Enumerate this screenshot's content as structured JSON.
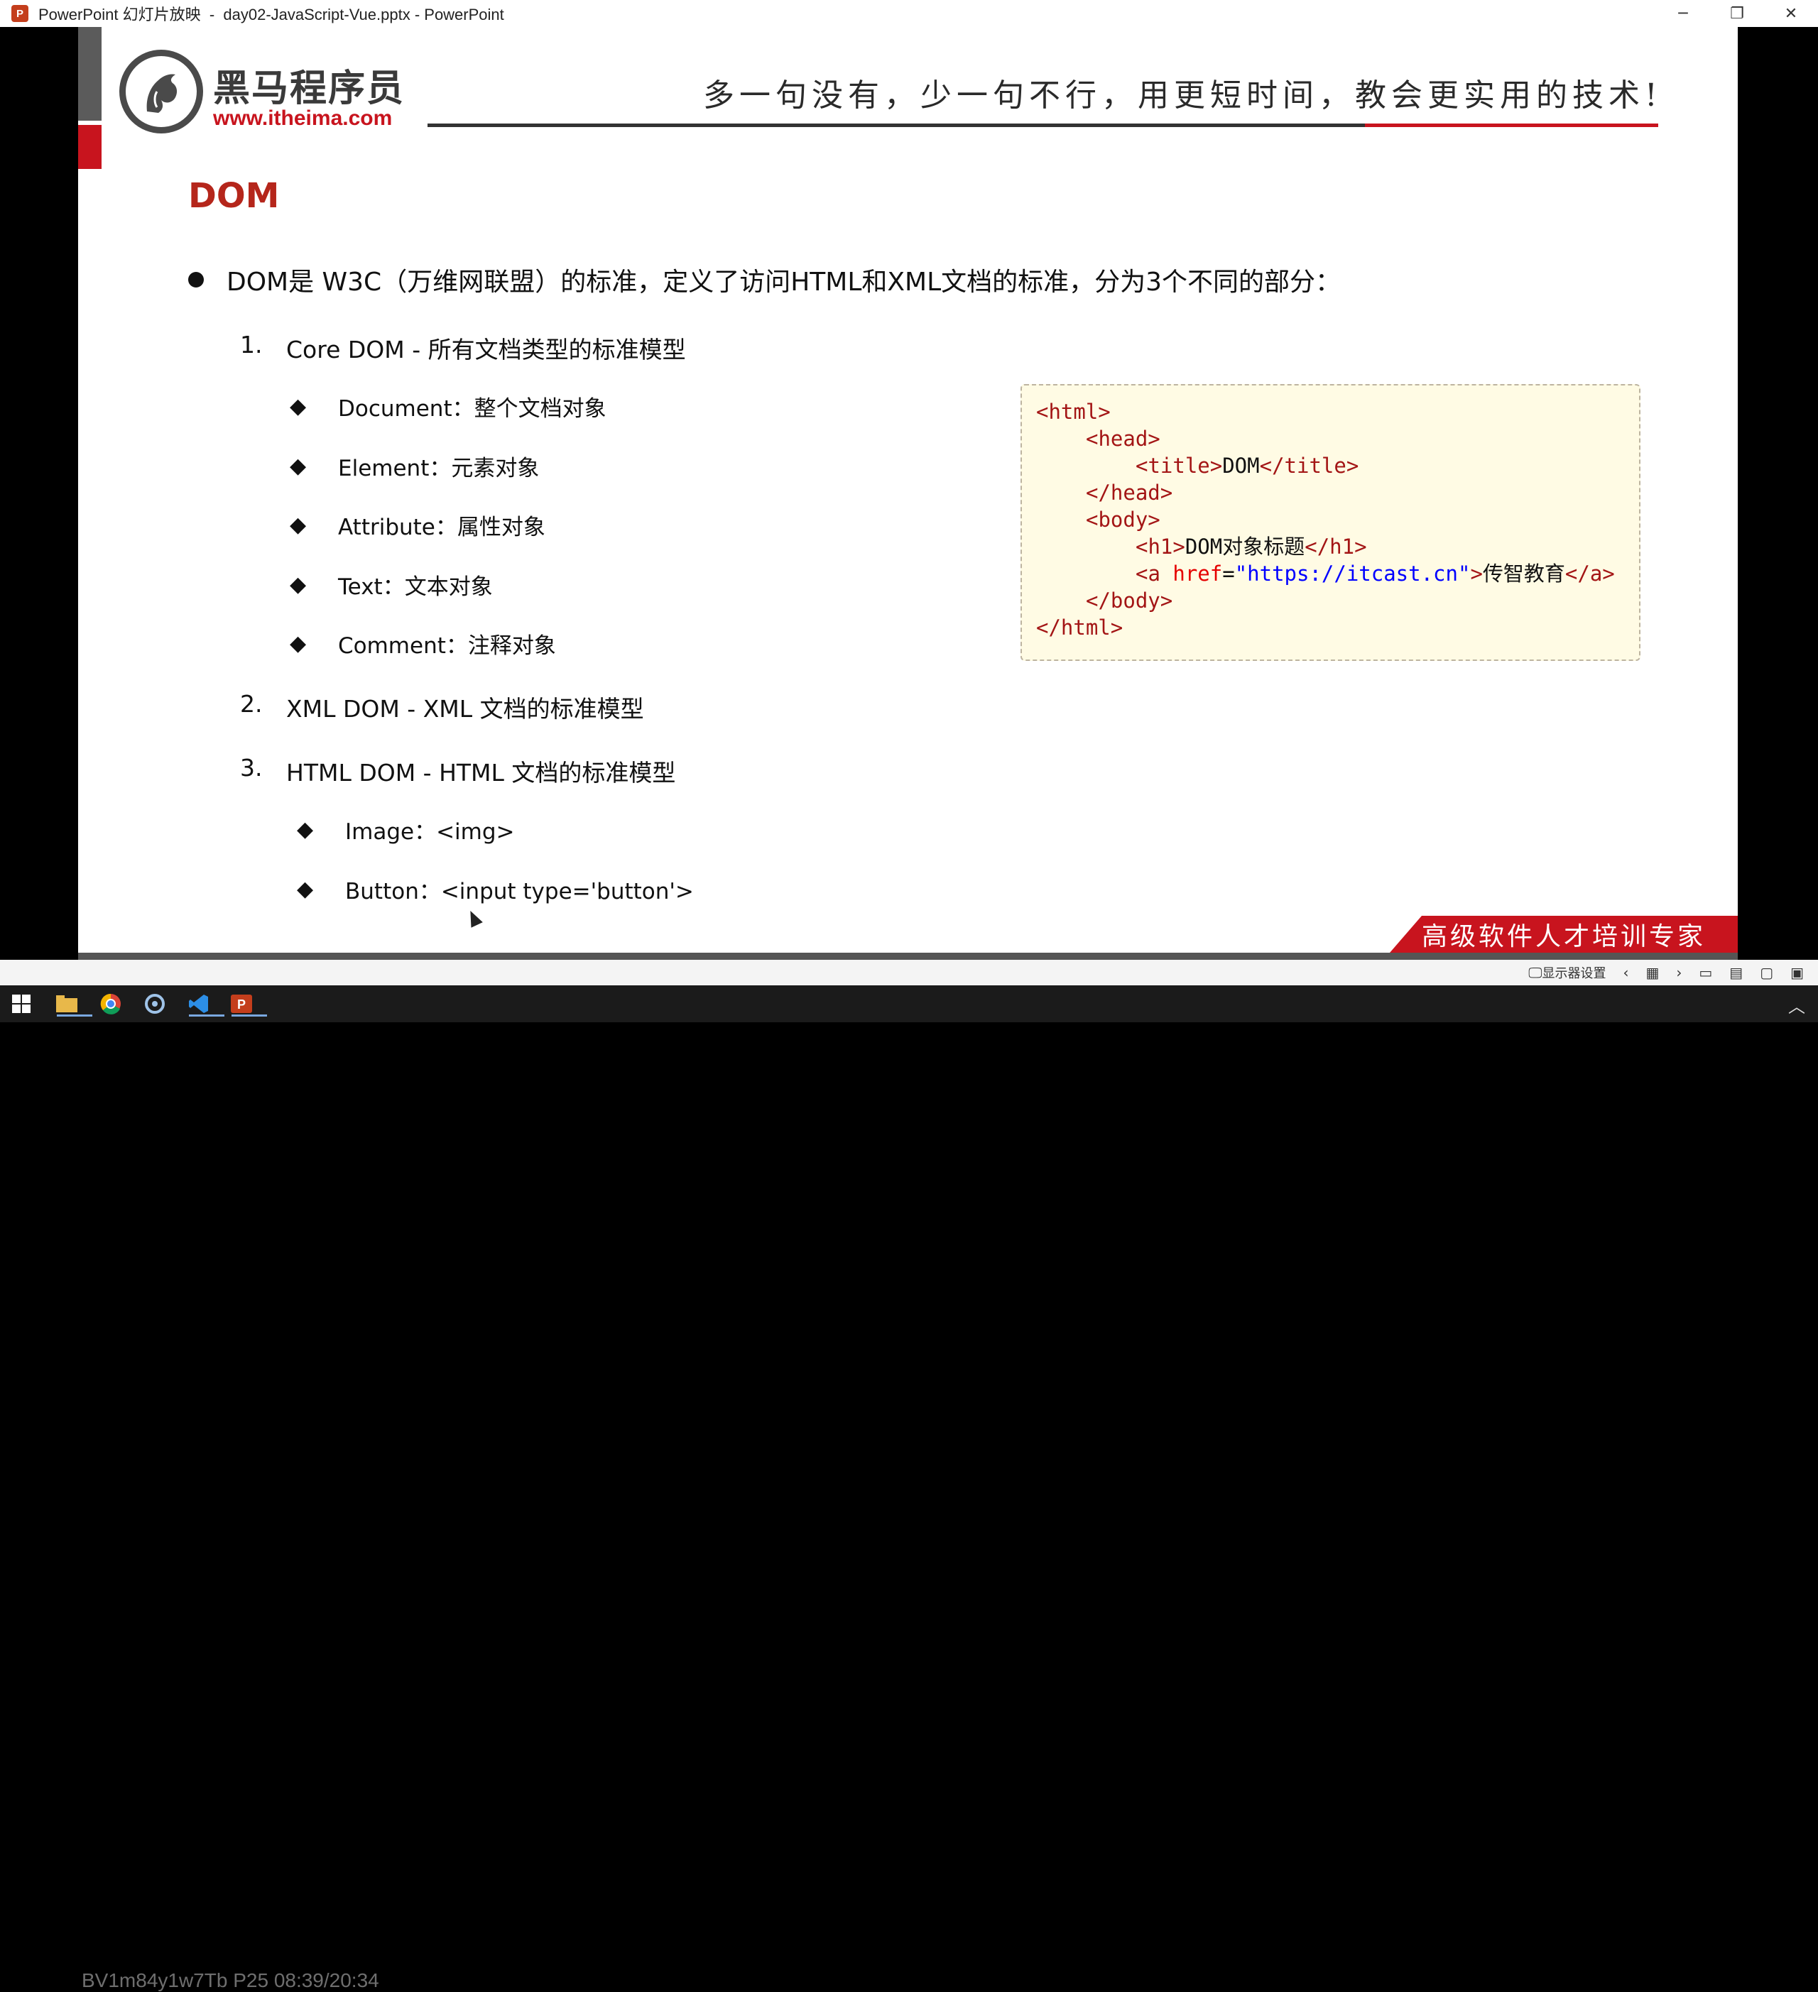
{
  "titlebar": {
    "title": "PowerPoint 幻灯片放映  -  day02-JavaScript-Vue.pptx - PowerPoint",
    "app_icon": "P",
    "minimize": "─",
    "restore": "❐",
    "close": "✕"
  },
  "slide": {
    "logo": {
      "name": "黑马程序员",
      "url": "www.itheima.com",
      "icon": "horse-icon"
    },
    "slogan": "多一句没有，少一句不行，用更短时间，教会更实用的技术!",
    "title": "DOM",
    "intro": "DOM是 W3C（万维网联盟）的标准，定义了访问HTML和XML文档的标准，分为3个不同的部分：",
    "parts": [
      {
        "num": "1.",
        "label": "Core DOM - 所有文档类型的标准模型",
        "subs": [
          "Document：整个文档对象",
          "Element：元素对象",
          "Attribute：属性对象",
          "Text：文本对象",
          "Comment：注释对象"
        ]
      },
      {
        "num": "2.",
        "label": "XML DOM - XML 文档的标准模型",
        "subs": []
      },
      {
        "num": "3.",
        "label": "HTML DOM - HTML 文档的标准模型",
        "subs": [
          "Image：<img>",
          "Button：<input type='button'>"
        ]
      }
    ],
    "code": {
      "l1": "<html>",
      "l2": "<head>",
      "l3_open": "<title>",
      "l3_text": "DOM",
      "l3_close": "</title>",
      "l4": "</head>",
      "l5": "<body>",
      "l6_open": "<h1>",
      "l6_text": "DOM对象标题",
      "l6_close": "</h1>",
      "l7_open": "<a ",
      "l7_attr": "href",
      "l7_eq": "=",
      "l7_val": "\"https://itcast.cn\"",
      "l7_gt": ">",
      "l7_text": "传智教育",
      "l7_close": "</a>",
      "l8": "</body>",
      "l9": "</html>"
    },
    "banner": "高级软件人才培训专家"
  },
  "presenter": {
    "display_settings": "显示器设置",
    "prev": "‹",
    "next": "›"
  },
  "taskbar": {
    "watermark": "BV1m84y1w7Tb P25 08:39/20:34",
    "tray_chevron": "︿"
  },
  "colors": {
    "brand_red": "#c8141e",
    "title_red": "#b5261b",
    "code_bg": "#fffbe4"
  }
}
